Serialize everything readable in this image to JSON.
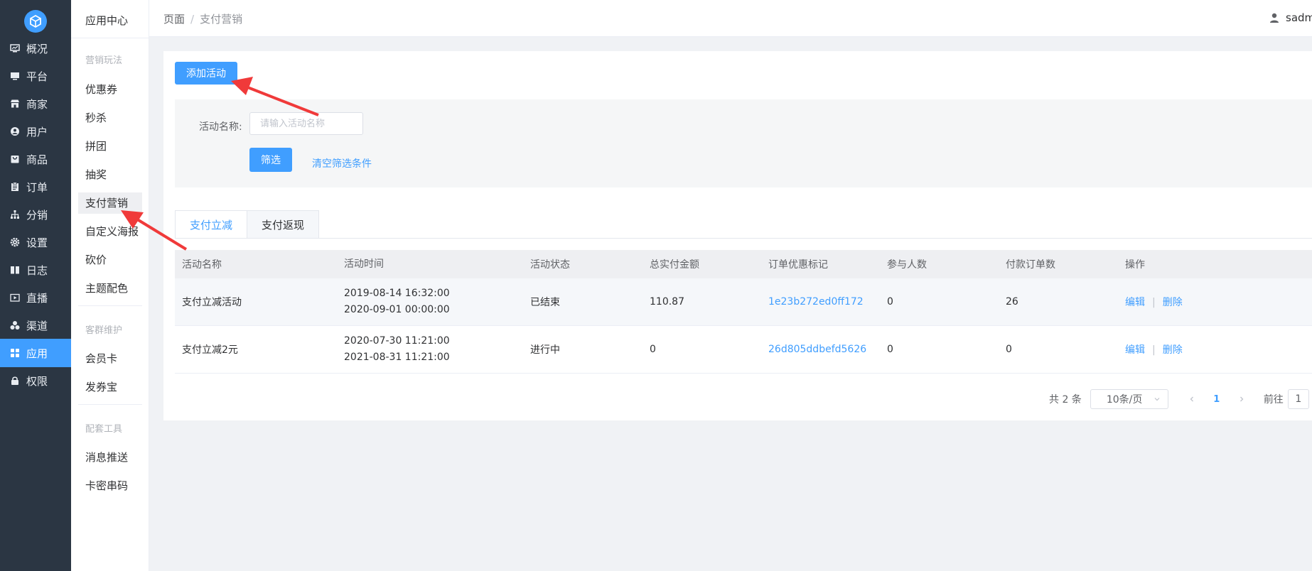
{
  "nav": {
    "items": [
      {
        "label": "概况",
        "icon": "monitor-icon"
      },
      {
        "label": "平台",
        "icon": "desktop-icon"
      },
      {
        "label": "商家",
        "icon": "store-icon"
      },
      {
        "label": "用户",
        "icon": "user-circle-icon"
      },
      {
        "label": "商品",
        "icon": "bag-icon"
      },
      {
        "label": "订单",
        "icon": "clipboard-icon"
      },
      {
        "label": "分销",
        "icon": "sitemap-icon"
      },
      {
        "label": "设置",
        "icon": "gear-icon"
      },
      {
        "label": "日志",
        "icon": "book-icon"
      },
      {
        "label": "直播",
        "icon": "video-icon"
      },
      {
        "label": "渠道",
        "icon": "cluster-icon"
      },
      {
        "label": "应用",
        "icon": "grid-icon"
      },
      {
        "label": "权限",
        "icon": "lock-icon"
      }
    ],
    "active_index": 11,
    "accent": "#409eff",
    "background": "#2b3643"
  },
  "submenu": {
    "title": "应用中心",
    "groups": [
      {
        "label": "营销玩法",
        "items": [
          "优惠券",
          "秒杀",
          "拼团",
          "抽奖",
          "支付营销",
          "自定义海报",
          "砍价",
          "主题配色"
        ]
      },
      {
        "label": "客群维护",
        "items": [
          "会员卡",
          "发券宝"
        ]
      },
      {
        "label": "配套工具",
        "items": [
          "消息推送",
          "卡密串码"
        ]
      }
    ],
    "active_item": "支付营销"
  },
  "header": {
    "breadcrumb": [
      "页面",
      "支付营销"
    ],
    "breadcrumb_sep": "/",
    "user": "sadm"
  },
  "main": {
    "add_button": "添加活动",
    "filter": {
      "name_label": "活动名称:",
      "name_placeholder": "请输入活动名称",
      "name_value": "",
      "submit": "筛选",
      "clear": "清空筛选条件"
    },
    "tabs": [
      {
        "label": "支付立减",
        "active": true
      },
      {
        "label": "支付返现",
        "active": false
      }
    ],
    "table": {
      "columns": [
        "活动名称",
        "活动时间",
        "活动状态",
        "总实付金额",
        "订单优惠标记",
        "参与人数",
        "付款订单数",
        "操作"
      ],
      "rows": [
        {
          "name": "支付立减活动",
          "start": "2019-08-14 16:32:00",
          "end": "2020-09-01 00:00:00",
          "status": "已结束",
          "amount": "110.87",
          "tag": "1e23b272ed0ff172",
          "people": "0",
          "orders": "26",
          "edit": "编辑",
          "delete": "删除"
        },
        {
          "name": "支付立减2元",
          "start": "2020-07-30 11:21:00",
          "end": "2021-08-31 11:21:00",
          "status": "进行中",
          "amount": "0",
          "tag": "26d805ddbefd5626",
          "people": "0",
          "orders": "0",
          "edit": "编辑",
          "delete": "删除"
        }
      ]
    },
    "pagination": {
      "total": "共 2 条",
      "page_size": "10条/页",
      "current_page": "1",
      "goto_label": "前往",
      "goto_value": "1"
    }
  },
  "annotations": {
    "arrow_color": "#f03a3a"
  }
}
